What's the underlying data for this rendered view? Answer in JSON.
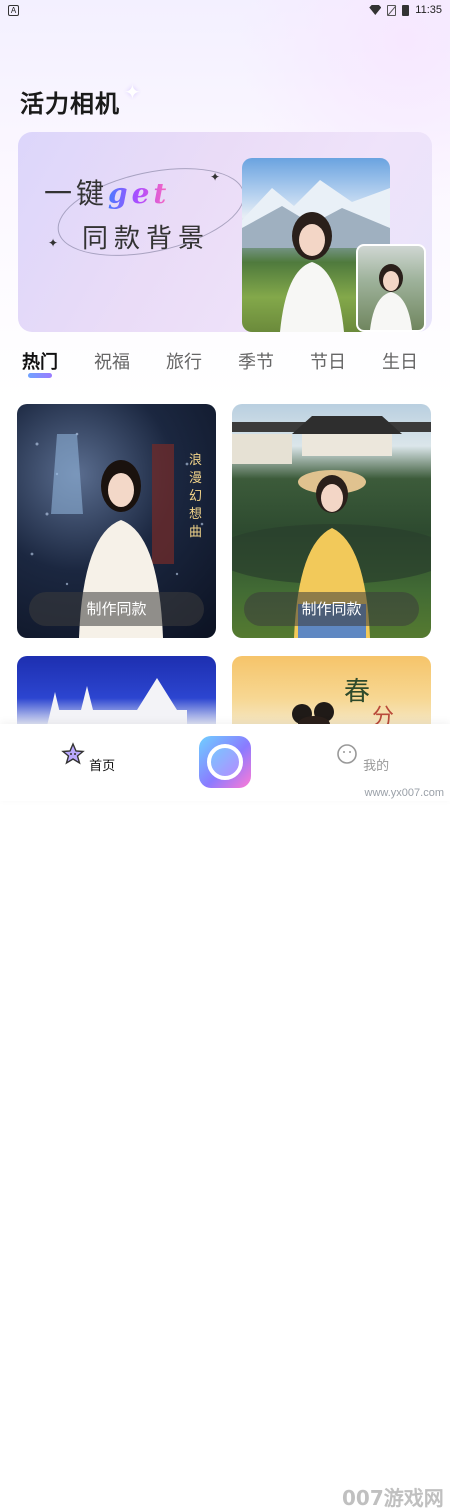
{
  "status_bar": {
    "time": "11:35",
    "left_icon": "A"
  },
  "header": {
    "app_title": "活力相机"
  },
  "banner": {
    "line1_prefix": "一键",
    "line1_highlight": "get",
    "line2": "同款背景"
  },
  "tabs": [
    {
      "label": "热门",
      "active": true
    },
    {
      "label": "祝福",
      "active": false
    },
    {
      "label": "旅行",
      "active": false
    },
    {
      "label": "季节",
      "active": false
    },
    {
      "label": "节日",
      "active": false
    },
    {
      "label": "生日",
      "active": false
    }
  ],
  "cards": [
    {
      "button": "制作同款",
      "deco_text": "浪漫幻想曲"
    },
    {
      "button": "制作同款"
    },
    {
      "button": ""
    },
    {
      "button": "",
      "deco_text": "春分"
    }
  ],
  "bottom_nav": {
    "home_label": "首页",
    "mine_label": "我的"
  },
  "watermark": {
    "big": "007游戏网",
    "url": "www.yx007.com"
  },
  "colors": {
    "accent_gradient_start": "#6fa2ff",
    "accent_gradient_end": "#9b7bff"
  }
}
